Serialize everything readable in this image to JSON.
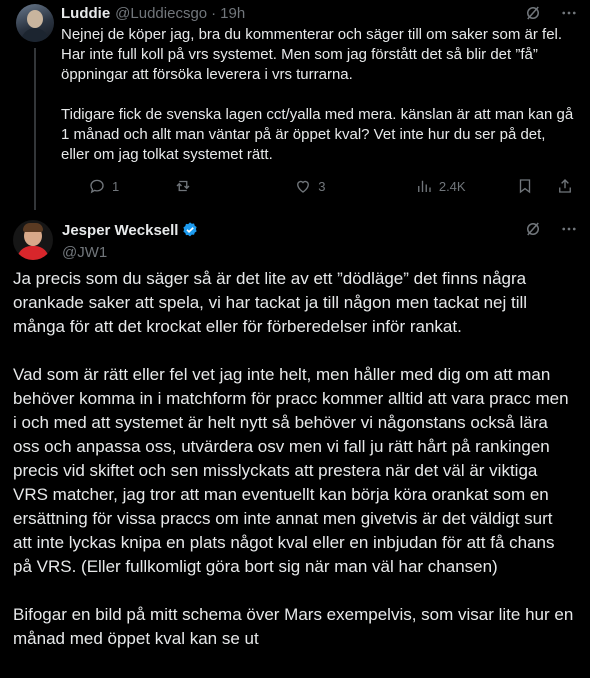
{
  "reply_tweet": {
    "author_name": "Luddie",
    "handle": "@Luddiecsgo",
    "separator": "·",
    "time": "19h",
    "text": "Nejnej de köper jag, bra du kommenterar och säger till om saker som är fel. Har inte full koll på vrs systemet. Men som jag förstått det så blir det ”få” öppningar att försöka leverera i vrs turrarna.\n\nTidigare fick de svenska lagen cct/yalla med mera. känslan är att man kan gå 1 månad och allt man väntar på är öppet kval? Vet inte hur du ser på det, eller om jag tolkat systemet rätt.",
    "stats": {
      "replies": "1",
      "reposts": "",
      "likes": "3",
      "views": "2.4K"
    }
  },
  "main_tweet": {
    "author_name": "Jesper Wecksell",
    "handle": "@JW1",
    "text": "Ja precis som du säger så är det lite av ett ”dödläge” det finns några orankade saker att spela, vi har tackat ja till någon men tackat nej till många för att det krockat eller för förberedelser inför rankat.\n\nVad som är rätt eller fel vet jag inte helt, men håller med dig om att man behöver komma in i matchform för pracc kommer alltid att vara pracc men i och med att systemet är helt nytt så behöver vi någonstans också lära oss och anpassa oss, utvärdera osv men vi fall ju rätt hårt på rankingen precis vid skiftet och sen misslyckats att prestera när det väl är viktiga VRS matcher, jag tror att man eventuellt kan börja köra orankat som en ersättning för vissa praccs om inte annat men givetvis är det väldigt surt att inte lyckas knipa en plats något kval eller en inbjudan för att få chans på VRS. (Eller fullkomligt göra bort sig när man väl har chansen)\n\nBifogar en bild på mitt schema över Mars exempelvis, som visar lite hur en månad med öppet kval kan se ut"
  },
  "icons": [
    "grok-slash-icon",
    "more-icon",
    "reply-icon",
    "repost-icon",
    "like-icon",
    "views-icon",
    "bookmark-icon",
    "share-icon",
    "verified-badge-icon"
  ],
  "colors": {
    "background": "#000000",
    "text": "#e7e9ea",
    "muted": "#71767b",
    "verified": "#1d9bf0"
  }
}
